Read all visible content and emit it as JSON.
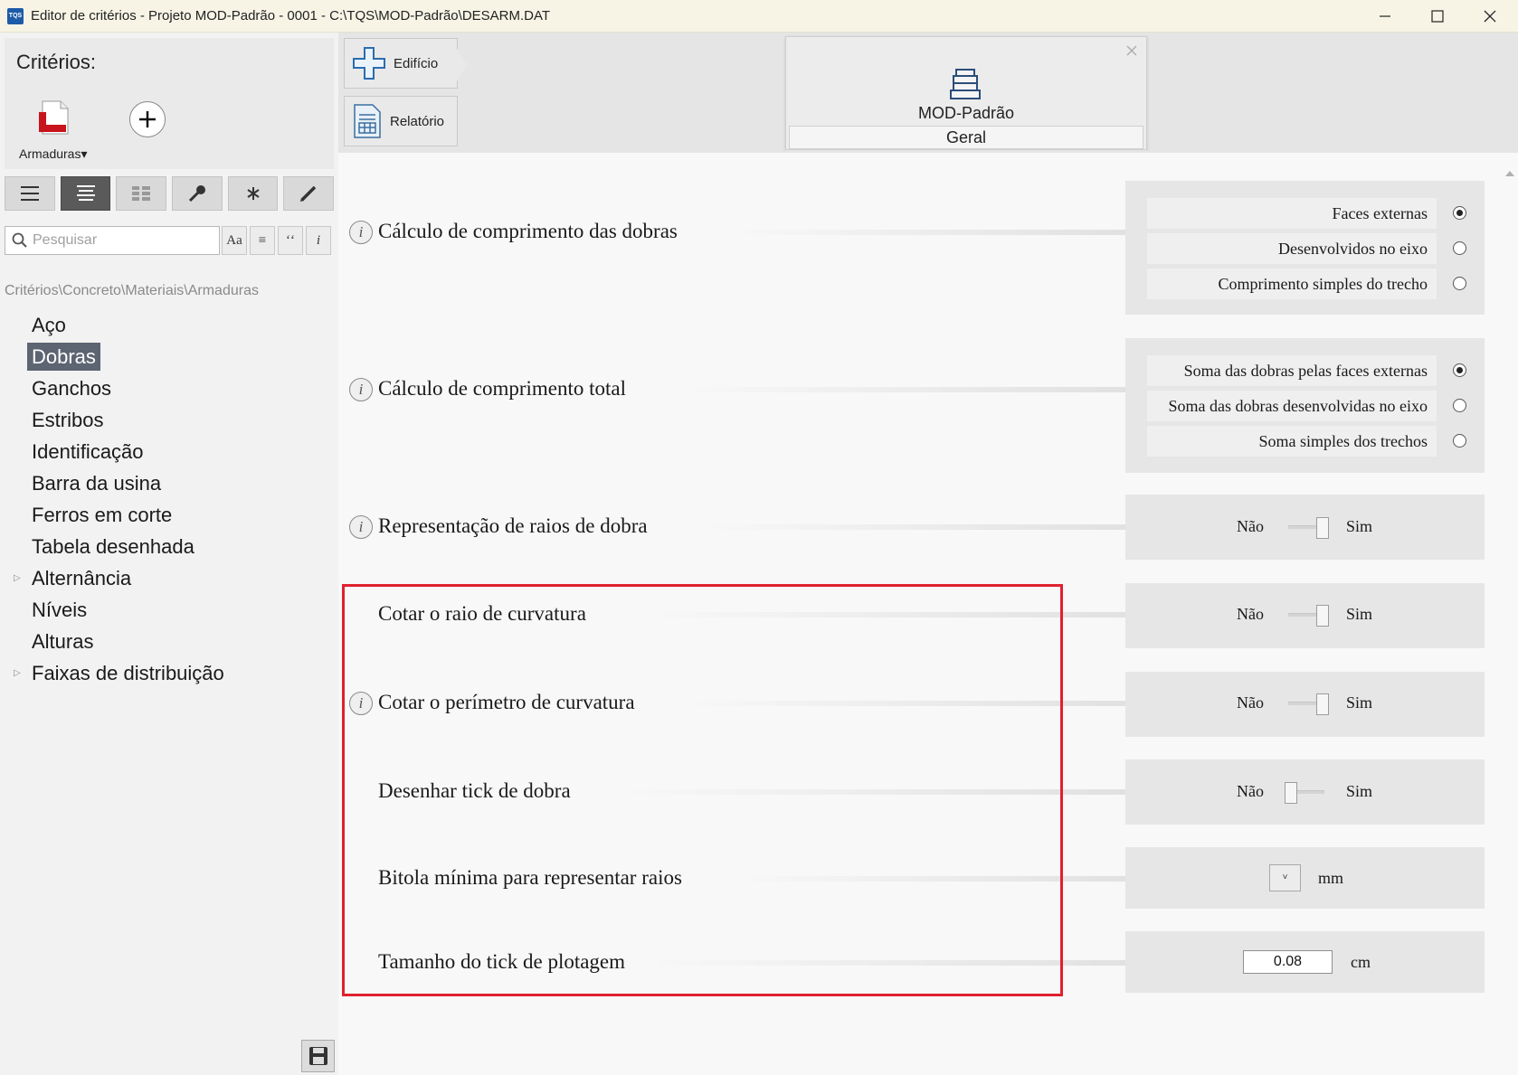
{
  "window": {
    "app_icon_text": "TQS",
    "title": "Editor de critérios - Projeto MOD-Padrão - 0001 - C:\\TQS\\MOD-Padrão\\DESARM.DAT"
  },
  "left": {
    "criterios_title": "Critérios:",
    "armaduras_label": "Armaduras▾",
    "search_placeholder": "Pesquisar",
    "search_buttons": [
      "Aa",
      "≡",
      "ʻʻ",
      "i"
    ],
    "breadcrumb": "Critérios\\Concreto\\Materiais\\Armaduras",
    "tree": [
      {
        "label": "Aço",
        "selected": false,
        "expandable": false
      },
      {
        "label": "Dobras",
        "selected": true,
        "expandable": false
      },
      {
        "label": "Ganchos",
        "selected": false,
        "expandable": false
      },
      {
        "label": "Estribos",
        "selected": false,
        "expandable": false
      },
      {
        "label": "Identificação",
        "selected": false,
        "expandable": false
      },
      {
        "label": "Barra da usina",
        "selected": false,
        "expandable": false
      },
      {
        "label": "Ferros em corte",
        "selected": false,
        "expandable": false
      },
      {
        "label": "Tabela desenhada",
        "selected": false,
        "expandable": false
      },
      {
        "label": "Alternância",
        "selected": false,
        "expandable": true
      },
      {
        "label": "Níveis",
        "selected": false,
        "expandable": false
      },
      {
        "label": "Alturas",
        "selected": false,
        "expandable": false
      },
      {
        "label": "Faixas de distribuição",
        "selected": false,
        "expandable": true
      }
    ]
  },
  "nav": {
    "edificio": "Edifício",
    "relatorio": "Relatório"
  },
  "model_card": {
    "title": "MOD-Padrão",
    "subtitle": "Geral"
  },
  "criteria": {
    "dobras_calc": {
      "label": "Cálculo de comprimento das dobras",
      "options": [
        "Faces externas",
        "Desenvolvidos no eixo",
        "Comprimento simples do trecho"
      ],
      "selected_index": 0
    },
    "total_calc": {
      "label": "Cálculo de comprimento total",
      "options": [
        "Soma das dobras pelas faces externas",
        "Soma das dobras desenvolvidas no eixo",
        "Soma simples dos trechos"
      ],
      "selected_index": 0
    },
    "toggle_off_label": "Não",
    "toggle_on_label": "Sim",
    "representacao": {
      "label": "Representação de raios de dobra",
      "value": "Sim"
    },
    "cotar_raio": {
      "label": "Cotar o raio de curvatura",
      "value": "Sim"
    },
    "cotar_perimetro": {
      "label": "Cotar o perímetro de curvatura",
      "value": "Sim"
    },
    "desenhar_tick": {
      "label": "Desenhar tick de dobra",
      "value": "Não"
    },
    "bitola": {
      "label": "Bitola mínima para representar raios",
      "value": "",
      "unit": "mm",
      "dropdown_glyph": "˅"
    },
    "tamanho_tick": {
      "label": "Tamanho do tick de plotagem",
      "value": "0.08",
      "unit": "cm"
    }
  },
  "colors": {
    "highlight": "#e0202f",
    "selected_tree_bg": "#5d6472"
  }
}
